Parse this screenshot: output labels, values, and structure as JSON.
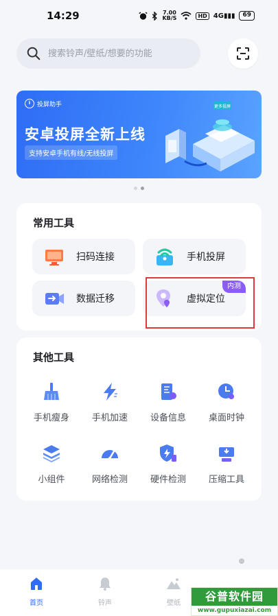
{
  "status_bar": {
    "time": "14:29",
    "speed_value": "7.00",
    "speed_unit": "KB/S",
    "network": "4G",
    "hd": "HD",
    "battery": "69"
  },
  "search": {
    "placeholder": "搜索铃声/壁纸/想要的功能"
  },
  "banner": {
    "logo_text": "投屏助手",
    "title": "安卓投屏全新上线",
    "subtitle": "支持安卓手机有线/无线投屏",
    "illustration_tag": "更多投屏"
  },
  "common_tools": {
    "title": "常用工具",
    "items": [
      {
        "label": "扫码连接",
        "icon": "monitor-icon"
      },
      {
        "label": "手机投屏",
        "icon": "wifi-cast-icon"
      },
      {
        "label": "数据迁移",
        "icon": "video-transfer-icon"
      },
      {
        "label": "虚拟定位",
        "icon": "location-pin-icon",
        "badge": "内测"
      }
    ]
  },
  "other_tools": {
    "title": "其他工具",
    "items": [
      {
        "label": "手机瘦身",
        "icon": "broom-icon"
      },
      {
        "label": "手机加速",
        "icon": "lightning-icon"
      },
      {
        "label": "设备信息",
        "icon": "device-info-icon"
      },
      {
        "label": "桌面时钟",
        "icon": "clock-icon"
      },
      {
        "label": "小组件",
        "icon": "layers-icon"
      },
      {
        "label": "网络检测",
        "icon": "speedometer-icon"
      },
      {
        "label": "硬件检测",
        "icon": "shield-icon"
      },
      {
        "label": "压缩工具",
        "icon": "compress-icon"
      }
    ]
  },
  "bottom_nav": {
    "items": [
      {
        "label": "首页",
        "active": true
      },
      {
        "label": "铃声",
        "active": false
      },
      {
        "label": "壁纸",
        "active": false
      }
    ]
  },
  "watermark": {
    "title": "谷普软件园",
    "url": "www.gupuxiazai.com"
  },
  "colors": {
    "accent": "#2f6df5",
    "badge": "#8b5cf6",
    "highlight": "#e2373b"
  }
}
